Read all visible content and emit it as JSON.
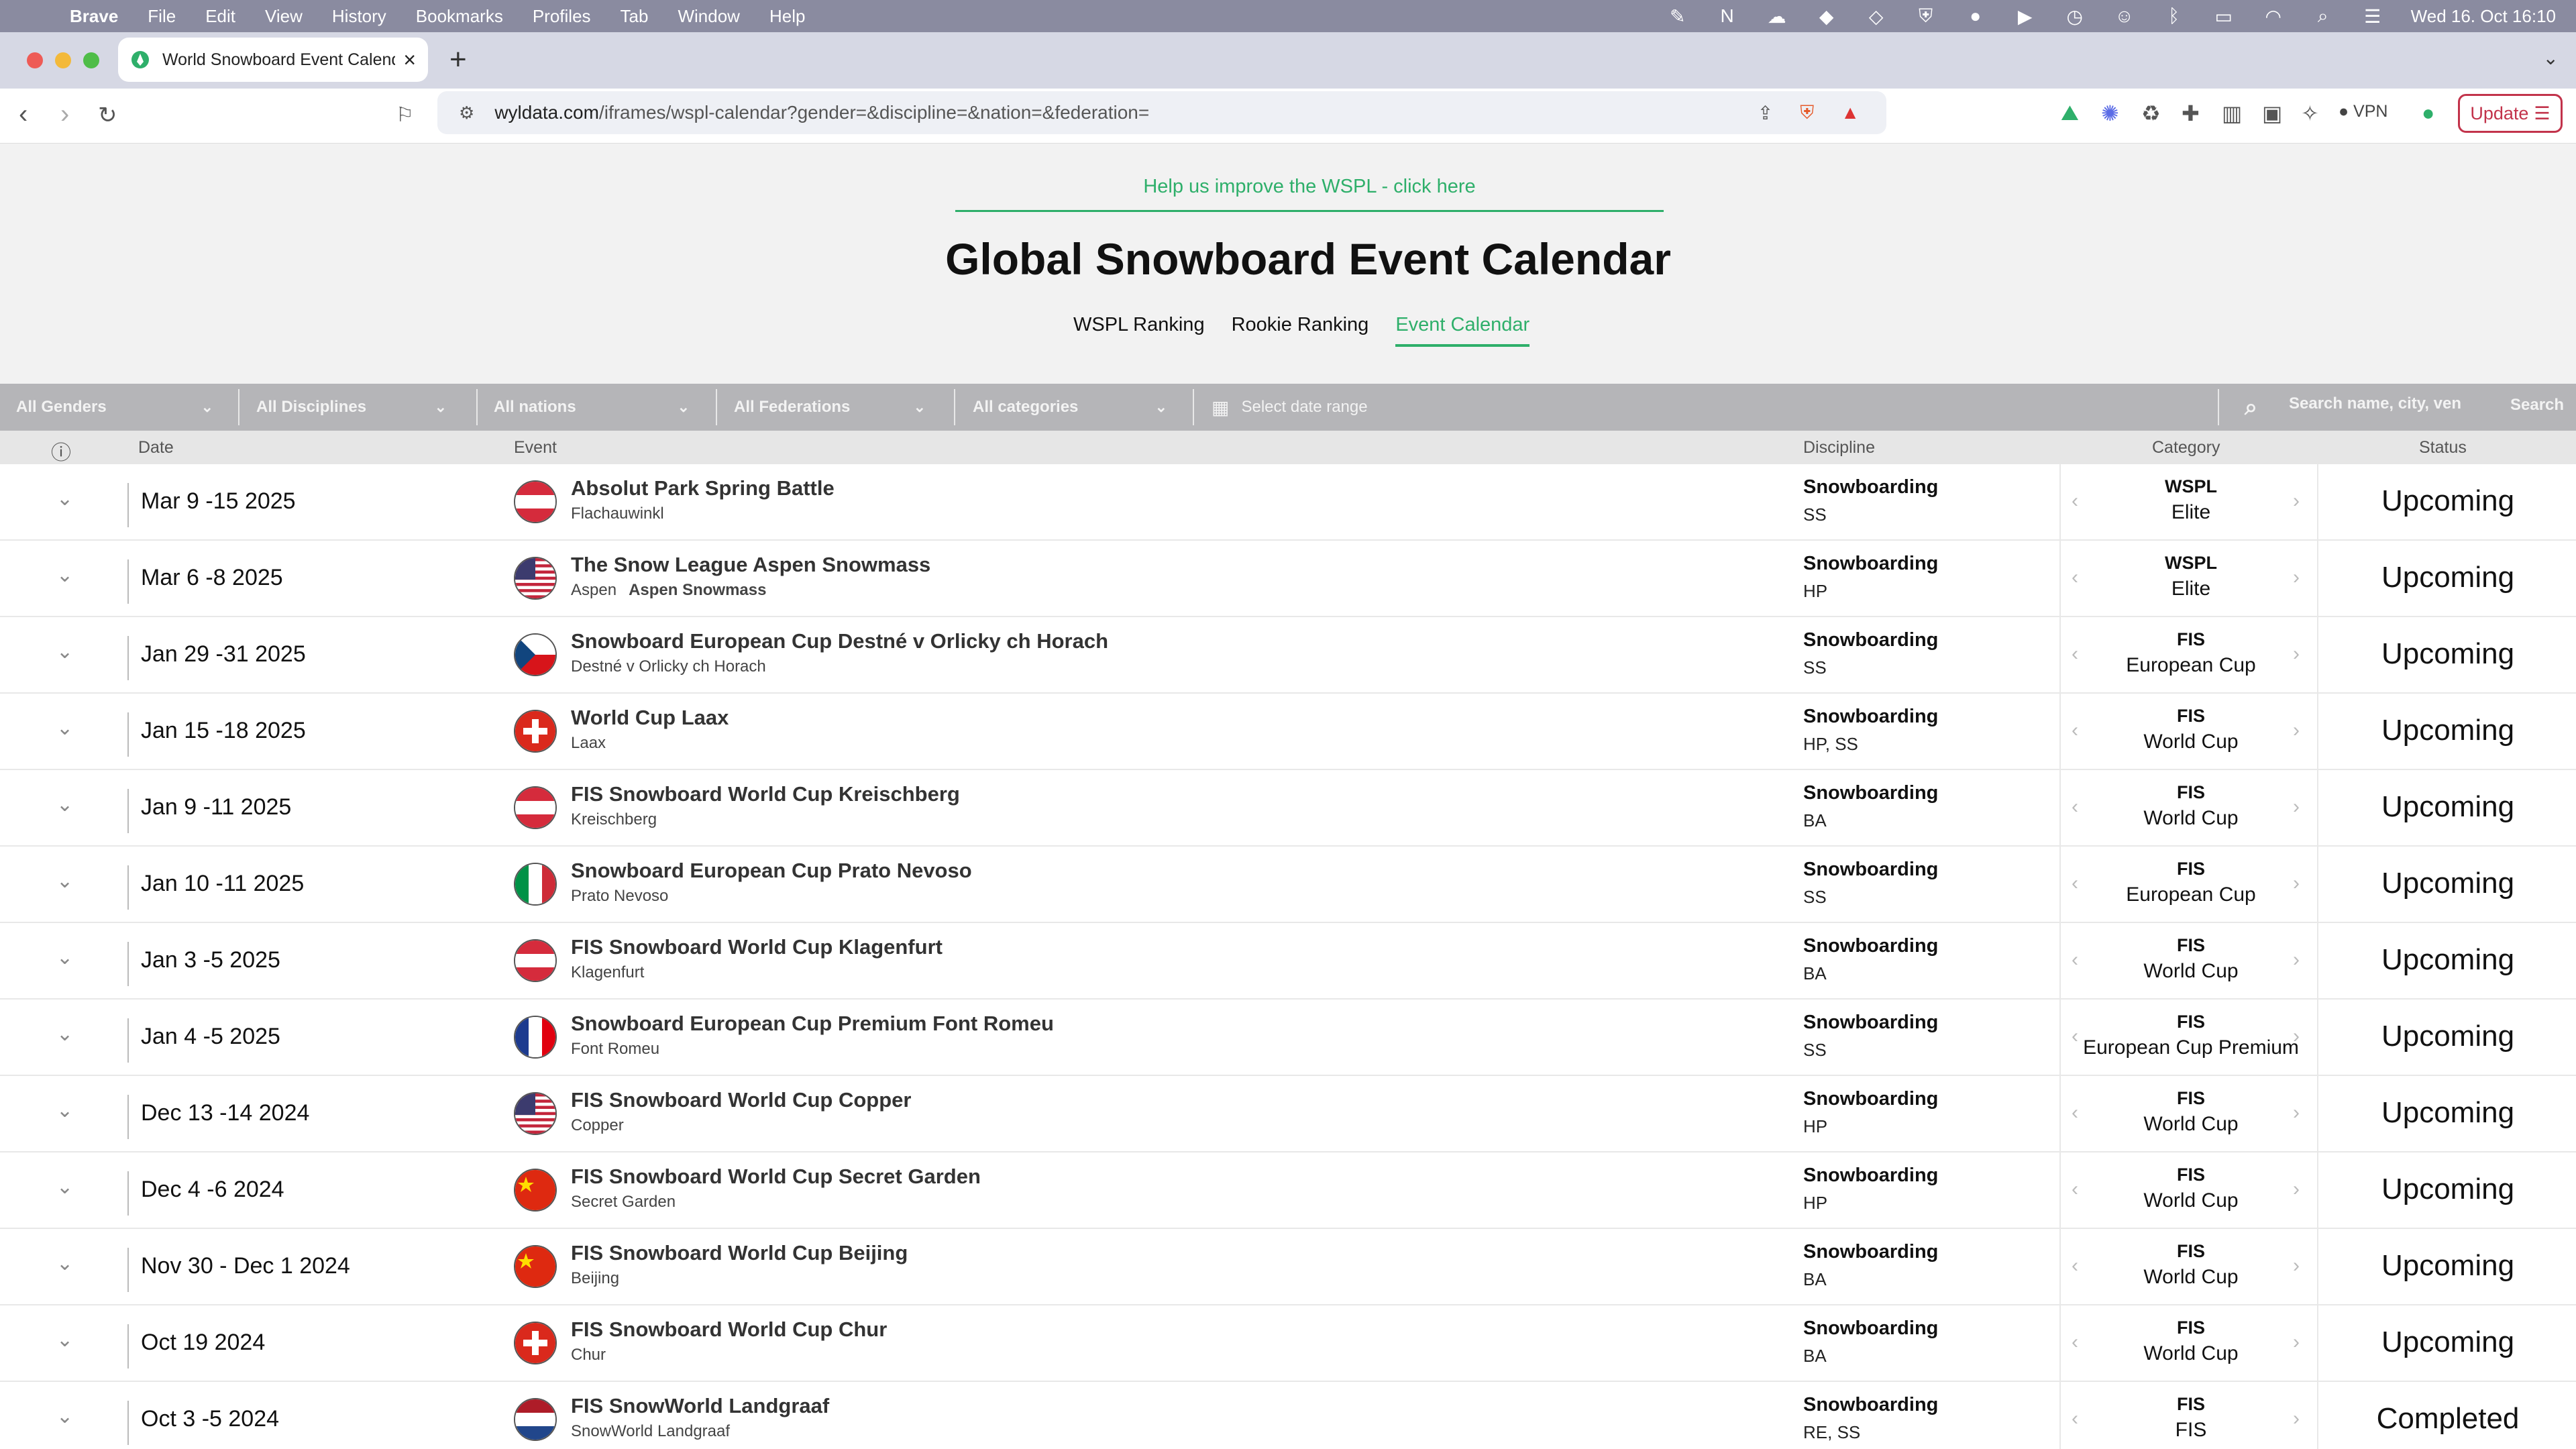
{
  "menubar": {
    "app": "Brave",
    "items": [
      "File",
      "Edit",
      "View",
      "History",
      "Bookmarks",
      "Profiles",
      "Tab",
      "Window",
      "Help"
    ],
    "clock": "Wed 16. Oct  16:10"
  },
  "browser": {
    "tab_title": "World Snowboard Event Calendar",
    "url_host": "wyldata.com",
    "url_path": "/iframes/wspl-calendar?gender=&discipline=&nation=&federation=",
    "vpn_label": "VPN",
    "update_label": "Update"
  },
  "page": {
    "help_link": "Help us improve the WSPL - click here",
    "title": "Global Snowboard Event Calendar",
    "nav": [
      {
        "label": "WSPL Ranking",
        "active": false
      },
      {
        "label": "Rookie Ranking",
        "active": false
      },
      {
        "label": "Event Calendar",
        "active": true
      }
    ]
  },
  "filters": {
    "gender": "All Genders",
    "discipline": "All Disciplines",
    "nation": "All nations",
    "federation": "All Federations",
    "category": "All categories",
    "date_placeholder": "Select date range",
    "search_placeholder": "Search name, city, ven",
    "search_button": "Search"
  },
  "table": {
    "headers": {
      "date": "Date",
      "event": "Event",
      "discipline": "Discipline",
      "category": "Category",
      "status": "Status"
    },
    "rows": [
      {
        "date": "Mar 9 -15 2025",
        "flag": "AT",
        "name": "Absolut Park Spring Battle",
        "location": "Flachauwinkl",
        "venue": "",
        "discipline": "Snowboarding",
        "disc_sub": "SS",
        "cat1": "WSPL",
        "cat2": "Elite",
        "status": "Upcoming"
      },
      {
        "date": "Mar 6 -8 2025",
        "flag": "US",
        "name": "The Snow League Aspen Snowmass",
        "location": "Aspen",
        "venue": "Aspen Snowmass",
        "discipline": "Snowboarding",
        "disc_sub": "HP",
        "cat1": "WSPL",
        "cat2": "Elite",
        "status": "Upcoming"
      },
      {
        "date": "Jan 29 -31 2025",
        "flag": "CZ",
        "name": "Snowboard European Cup Destné v Orlicky ch Horach",
        "location": "Destné v Orlicky ch Horach",
        "venue": "",
        "discipline": "Snowboarding",
        "disc_sub": "SS",
        "cat1": "FIS",
        "cat2": "European Cup",
        "status": "Upcoming"
      },
      {
        "date": "Jan 15 -18 2025",
        "flag": "CH",
        "name": "World Cup Laax",
        "location": "Laax",
        "venue": "",
        "discipline": "Snowboarding",
        "disc_sub": "HP, SS",
        "cat1": "FIS",
        "cat2": "World Cup",
        "status": "Upcoming"
      },
      {
        "date": "Jan 9 -11 2025",
        "flag": "AT",
        "name": "FIS Snowboard World Cup Kreischberg",
        "location": "Kreischberg",
        "venue": "",
        "discipline": "Snowboarding",
        "disc_sub": "BA",
        "cat1": "FIS",
        "cat2": "World Cup",
        "status": "Upcoming"
      },
      {
        "date": "Jan 10 -11 2025",
        "flag": "IT",
        "name": "Snowboard European Cup Prato Nevoso",
        "location": "Prato Nevoso",
        "venue": "",
        "discipline": "Snowboarding",
        "disc_sub": "SS",
        "cat1": "FIS",
        "cat2": "European Cup",
        "status": "Upcoming"
      },
      {
        "date": "Jan 3 -5 2025",
        "flag": "AT",
        "name": "FIS Snowboard World Cup Klagenfurt",
        "location": "Klagenfurt",
        "venue": "",
        "discipline": "Snowboarding",
        "disc_sub": "BA",
        "cat1": "FIS",
        "cat2": "World Cup",
        "status": "Upcoming"
      },
      {
        "date": "Jan 4 -5 2025",
        "flag": "FR",
        "name": "Snowboard European Cup Premium Font Romeu",
        "location": "Font Romeu",
        "venue": "",
        "discipline": "Snowboarding",
        "disc_sub": "SS",
        "cat1": "FIS",
        "cat2": "European Cup Premium",
        "status": "Upcoming"
      },
      {
        "date": "Dec 13 -14 2024",
        "flag": "US",
        "name": "FIS Snowboard World Cup Copper",
        "location": "Copper",
        "venue": "",
        "discipline": "Snowboarding",
        "disc_sub": "HP",
        "cat1": "FIS",
        "cat2": "World Cup",
        "status": "Upcoming"
      },
      {
        "date": "Dec 4 -6 2024",
        "flag": "CN",
        "name": "FIS Snowboard World Cup Secret Garden",
        "location": "Secret Garden",
        "venue": "",
        "discipline": "Snowboarding",
        "disc_sub": "HP",
        "cat1": "FIS",
        "cat2": "World Cup",
        "status": "Upcoming"
      },
      {
        "date": "Nov 30 - Dec 1 2024",
        "flag": "CN",
        "name": "FIS Snowboard World Cup Beijing",
        "location": "Beijing",
        "venue": "",
        "discipline": "Snowboarding",
        "disc_sub": "BA",
        "cat1": "FIS",
        "cat2": "World Cup",
        "status": "Upcoming"
      },
      {
        "date": "Oct 19 2024",
        "flag": "CH",
        "name": "FIS Snowboard World Cup Chur",
        "location": "Chur",
        "venue": "",
        "discipline": "Snowboarding",
        "disc_sub": "BA",
        "cat1": "FIS",
        "cat2": "World Cup",
        "status": "Upcoming"
      },
      {
        "date": "Oct 3 -5 2024",
        "flag": "NL",
        "name": "FIS SnowWorld Landgraaf",
        "location": "SnowWorld Landgraaf",
        "venue": "",
        "discipline": "Snowboarding",
        "disc_sub": "RE, SS",
        "cat1": "FIS",
        "cat2": "FIS",
        "status": "Completed"
      }
    ]
  }
}
